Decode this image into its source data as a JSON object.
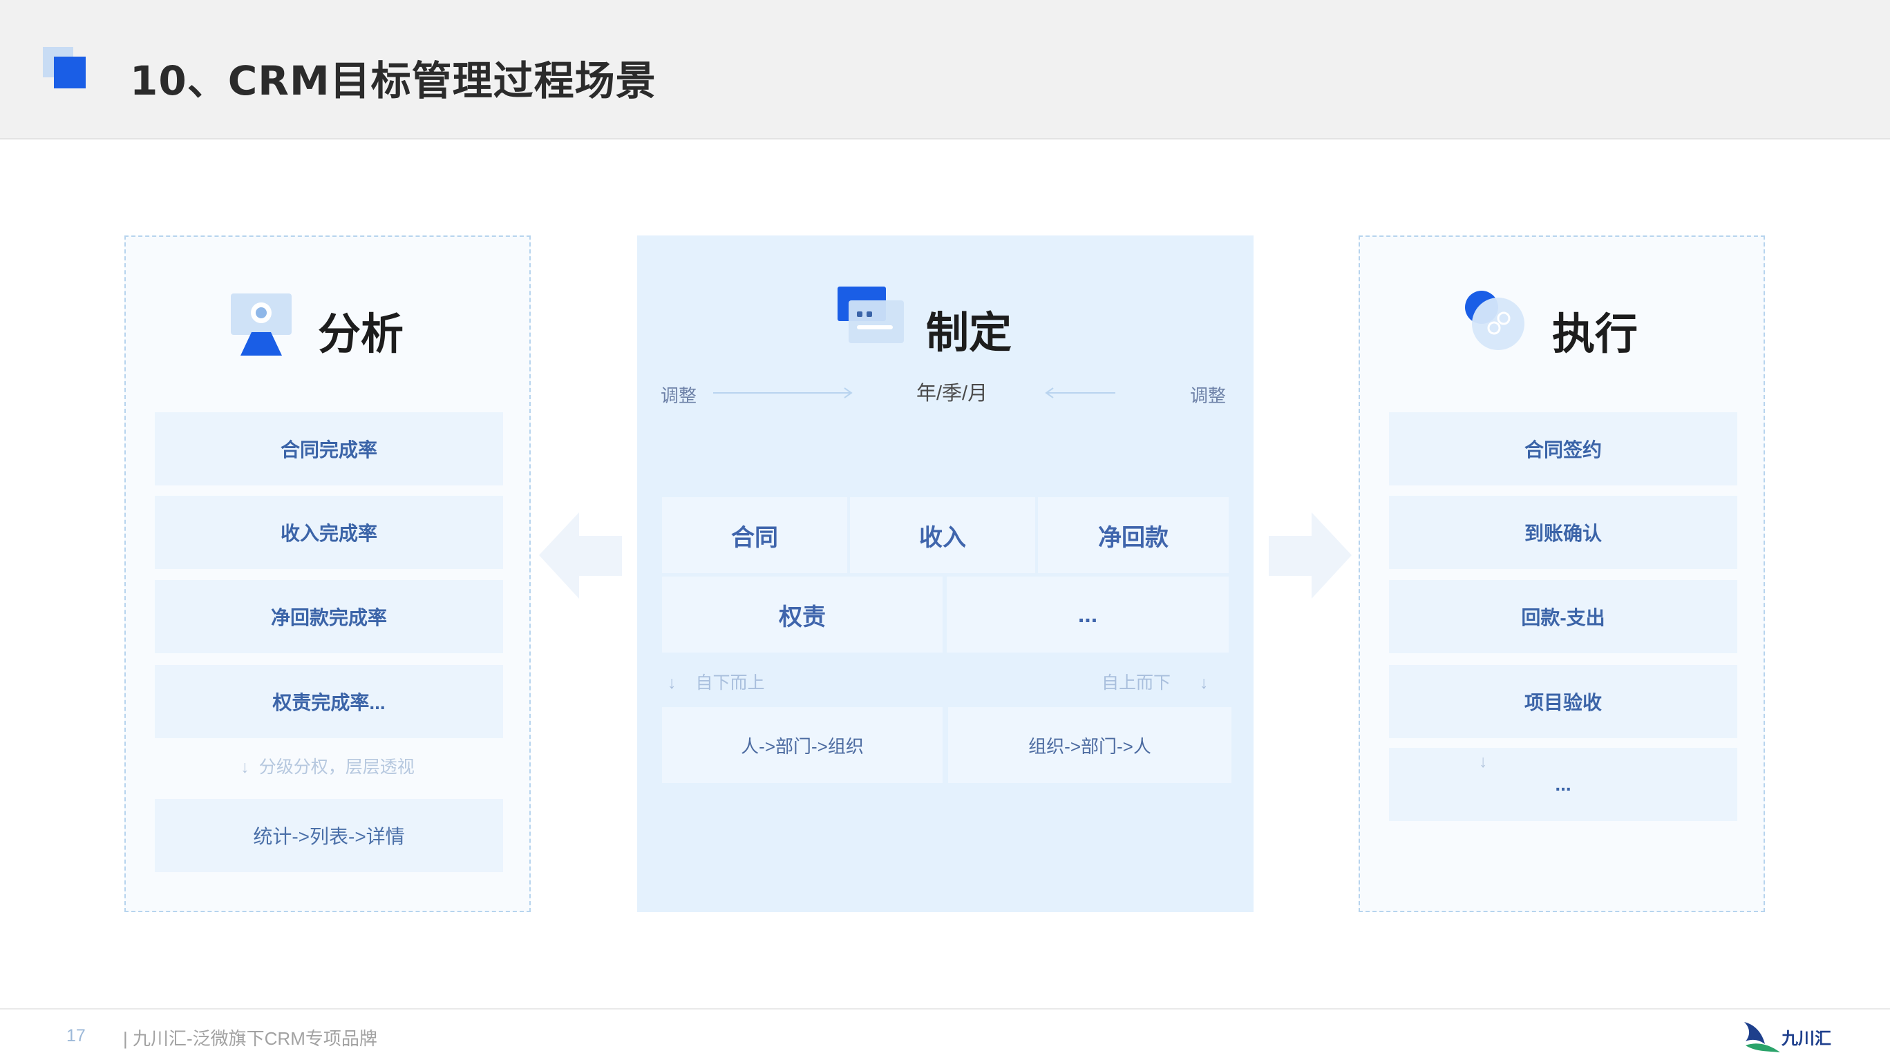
{
  "header": {
    "title": "10、CRM目标管理过程场景"
  },
  "left": {
    "title": "分析",
    "items": [
      "合同完成率",
      "收入完成率",
      "净回款完成率",
      "权责完成率..."
    ],
    "note": "分级分权，层层透视",
    "bottom_item": "统计->列表->详情"
  },
  "center": {
    "title": "制定",
    "adjust_left": "调整",
    "adjust_right": "调整",
    "period": "年/季/月",
    "row1": [
      "合同",
      "收入",
      "净回款"
    ],
    "row2": [
      "权责",
      "..."
    ],
    "bottom_up": "自下而上",
    "top_down": "自上而下",
    "flow_left": "人->部门->组织",
    "flow_right": "组织->部门->人"
  },
  "right": {
    "title": "执行",
    "items": [
      "合同签约",
      "到账确认",
      "回款-支出",
      "项目验收",
      "..."
    ]
  },
  "footer": {
    "page_number": "17",
    "text": "| 九川汇-泛微旗下CRM专项品牌",
    "brand": "九川汇"
  },
  "colors": {
    "accent": "#1a5ee6",
    "item_bg": "#ebf4fd",
    "center_bg": "#e4f1fd",
    "item_text": "#3b64a8"
  }
}
